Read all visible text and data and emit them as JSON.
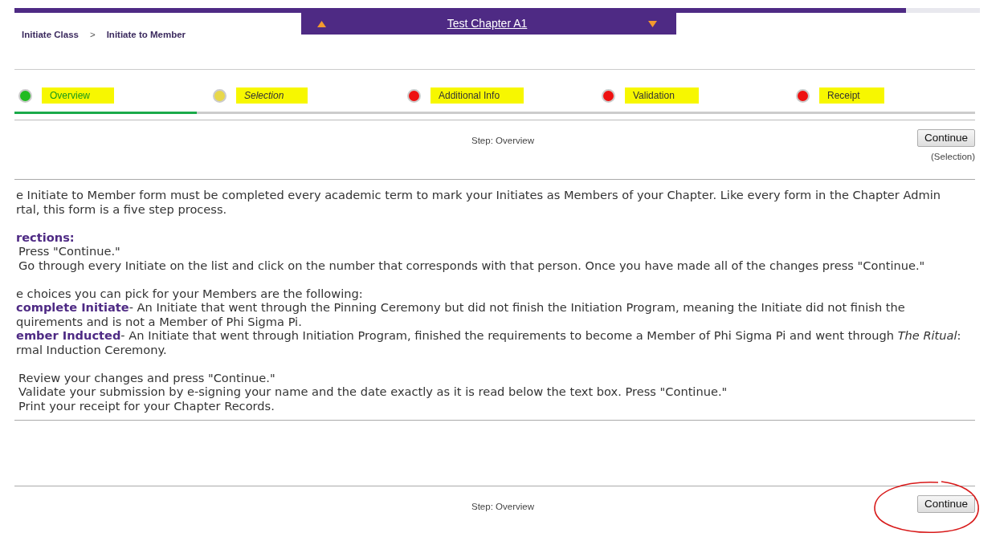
{
  "chapter_selector": {
    "label": "Test Chapter A1"
  },
  "breadcrumb": [
    "Initiate Class",
    ">",
    "Initiate to Member"
  ],
  "steps": [
    {
      "label": "Overview",
      "color": "#22bb22",
      "selected": true,
      "upcoming": false,
      "highlighted": true
    },
    {
      "label": "Selection",
      "color": "#e8d84a",
      "selected": false,
      "upcoming": true,
      "highlighted": true
    },
    {
      "label": "Additional Info",
      "color": "#ee1111",
      "selected": false,
      "upcoming": false,
      "highlighted": true
    },
    {
      "label": "Validation",
      "color": "#ee1111",
      "selected": false,
      "upcoming": false,
      "highlighted": true
    },
    {
      "label": "Receipt",
      "color": "#ee1111",
      "selected": false,
      "upcoming": false,
      "highlighted": true
    }
  ],
  "progress": {
    "level": 0.19
  },
  "top_step_bar": {
    "step_label": "Step: Overview",
    "button": "Continue",
    "next_label": "(Selection)"
  },
  "paragraphs": [
    [
      {
        "kind": "text",
        "text": "e Initiate to Member form must be completed every academic term to mark your Initiates as Members of your Chapter. Like every form in the Chapter Admin"
      },
      {
        "kind": "text",
        "text": "rtal, this form is a five step process."
      }
    ],
    [
      {
        "kind": "heading",
        "text": "rections:"
      },
      {
        "kind": "step",
        "text": "Press \"Continue.\""
      },
      {
        "kind": "step",
        "text": "Go through every Initiate on the list and click on the number that corresponds with that person. Once you have made all of the changes press \"Continue.\""
      }
    ],
    [
      {
        "kind": "text",
        "text": "e choices you can pick for your Members are the following:"
      },
      {
        "kind": "text",
        "text": "**complete Initiate**- An Initiate that went through the Pinning Ceremony but did not finish the Initiation Program, meaning the Initiate did not finish the"
      },
      {
        "kind": "text",
        "text": "quirements and is not a Member of Phi Sigma Pi."
      },
      {
        "kind": "text",
        "text": "**ember Inducted**- An Initiate that went through Initiation Program, finished the requirements to become a Member of Phi Sigma Pi and went through *The Ritual*:"
      },
      {
        "kind": "text",
        "text": "rmal Induction Ceremony."
      }
    ],
    [
      {
        "kind": "step",
        "text": "Review your changes and press \"Continue.\""
      },
      {
        "kind": "step",
        "text": "Validate your submission by e-signing your name and the date exactly as it is read below the text box. Press \"Continue.\""
      },
      {
        "kind": "step",
        "text": "Print your receipt for your Chapter Records."
      }
    ]
  ],
  "bottom_step_bar": {
    "step_label": "Step: Overview",
    "button": "Continue",
    "circled": true
  }
}
